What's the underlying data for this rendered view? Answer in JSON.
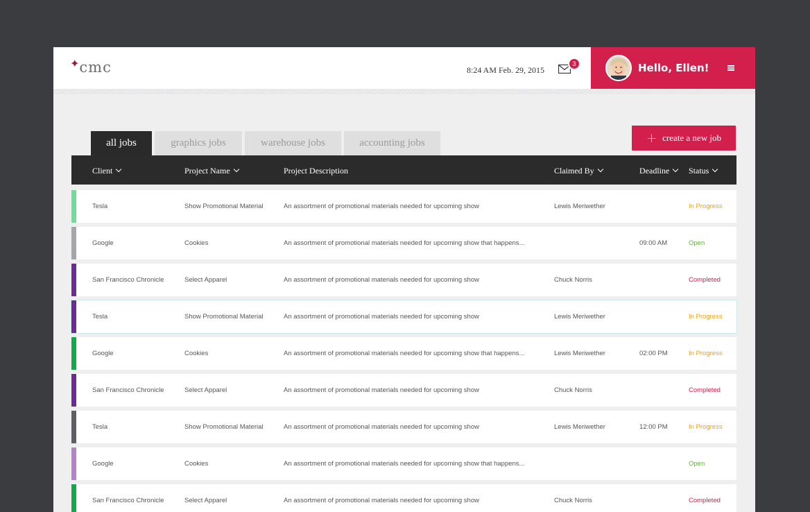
{
  "header": {
    "logo_text": "cmc",
    "logo_star": "✦",
    "datetime": "8:24 AM Feb. 29, 2015",
    "mail_badge": "3",
    "greeting": "Hello, Ellen!"
  },
  "tabs": [
    {
      "label": "all jobs",
      "active": true
    },
    {
      "label": "graphics jobs",
      "active": false
    },
    {
      "label": "warehouse jobs",
      "active": false
    },
    {
      "label": "accounting jobs",
      "active": false
    }
  ],
  "create_button": {
    "plus": "+",
    "label": "create a new job"
  },
  "columns": {
    "client": "Client",
    "project": "Project Name",
    "description": "Project Description",
    "claimed": "Claimed By",
    "deadline": "Deadline",
    "status": "Status"
  },
  "colors": {
    "accent": "#d31f4c",
    "in_progress": "#e9a21b",
    "open": "#5fb832",
    "completed": "#d31f4c"
  },
  "rows": [
    {
      "bar": "#6fdc9a",
      "client": "Tesla",
      "project": "Show Promotional Material",
      "description": "An assortment of promotional materials needed for upcoming show",
      "claimed": "Lewis Meriwether",
      "deadline": "",
      "status": "In Progress",
      "status_key": "in_progress"
    },
    {
      "bar": "#a4a6a9",
      "client": "Google",
      "project": "Cookies",
      "description": "An assortment of promotional materials needed for upcoming show that happens...",
      "claimed": "",
      "deadline": "09:00 AM",
      "status": "Open",
      "status_key": "open"
    },
    {
      "bar": "#6c2a93",
      "client": "San Francisco Chronicle",
      "project": "Select Apparel",
      "description": "An assortment of promotional materials needed for upcoming show",
      "claimed": "Chuck Norris",
      "deadline": "",
      "status": "Completed",
      "status_key": "completed"
    },
    {
      "bar": "#6c2a93",
      "client": "Tesla",
      "project": "Show Promotional Material",
      "description": "An assortment of promotional materials needed for upcoming show",
      "claimed": "Lewis Meriwether",
      "deadline": "",
      "status": "In Progress",
      "status_key": "in_progress",
      "highlight": true
    },
    {
      "bar": "#0faa4a",
      "client": "Google",
      "project": "Cookies",
      "description": "An assortment of promotional materials needed for upcoming show that happens...",
      "claimed": "Lewis Meriwether",
      "deadline": "02:00 PM",
      "status": "In Progress",
      "status_key": "in_progress"
    },
    {
      "bar": "#6c2a93",
      "client": "San Francisco Chronicle",
      "project": "Select Apparel",
      "description": "An assortment of promotional materials needed for upcoming show",
      "claimed": "Chuck Norris",
      "deadline": "",
      "status": "Completed",
      "status_key": "completed"
    },
    {
      "bar": "#5a6064",
      "client": "Tesla",
      "project": "Show Promotional Material",
      "description": "An assortment of promotional materials needed for upcoming show",
      "claimed": "Lewis Meriwether",
      "deadline": "12:00 PM",
      "status": "In Progress",
      "status_key": "in_progress"
    },
    {
      "bar": "#b383cc",
      "client": "Google",
      "project": "Cookies",
      "description": "An assortment of promotional materials needed for upcoming show that happens...",
      "claimed": "",
      "deadline": "",
      "status": "Open",
      "status_key": "open"
    },
    {
      "bar": "#0faa4a",
      "client": "San Francisco Chronicle",
      "project": "Select Apparel",
      "description": "An assortment of promotional materials needed for upcoming show",
      "claimed": "Chuck Norris",
      "deadline": "",
      "status": "Completed",
      "status_key": "completed"
    }
  ]
}
